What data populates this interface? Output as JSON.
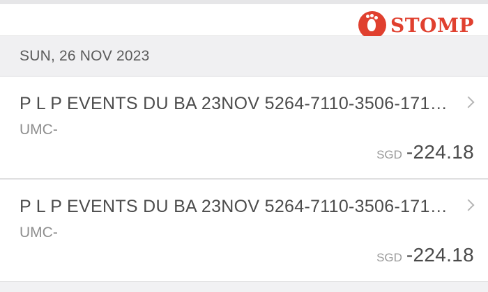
{
  "watermark": {
    "text": "STOMP"
  },
  "date_header": "SUN, 26 NOV 2023",
  "transactions": [
    {
      "description": "P L P EVENTS DU BA 23NOV 5264-7110-3506-171…",
      "subtitle": "UMC-",
      "currency": "SGD",
      "amount": "-224.18"
    },
    {
      "description": "P L P EVENTS DU BA 23NOV 5264-7110-3506-171…",
      "subtitle": "UMC-",
      "currency": "SGD",
      "amount": "-224.18"
    }
  ],
  "colors": {
    "brand": "#e0402f",
    "background": "#f1f1f3"
  },
  "icons": {
    "row_chevron": "chevron-right-icon"
  }
}
